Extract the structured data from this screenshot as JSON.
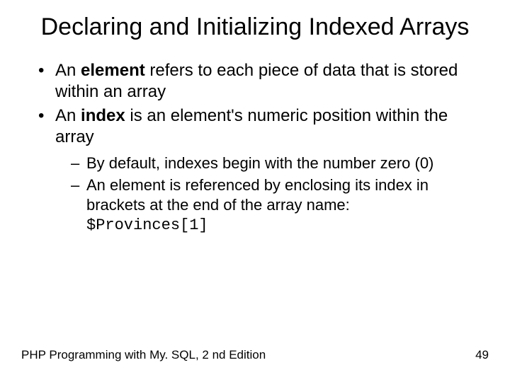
{
  "title": "Declaring and Initializing Indexed Arrays",
  "bullets": {
    "b1_pre": "An ",
    "b1_bold": "element",
    "b1_post": " refers to each piece of data that is stored within an array",
    "b2_pre": "An ",
    "b2_bold": "index",
    "b2_post": " is an element's numeric position within the array",
    "sub1": "By default, indexes begin with the number zero (0)",
    "sub2_text": "An element is referenced by enclosing its index in brackets at the end of the array name: ",
    "sub2_code": "$Provinces[1]"
  },
  "footer": {
    "left": "PHP Programming with My. SQL, 2 nd Edition",
    "right": "49"
  }
}
